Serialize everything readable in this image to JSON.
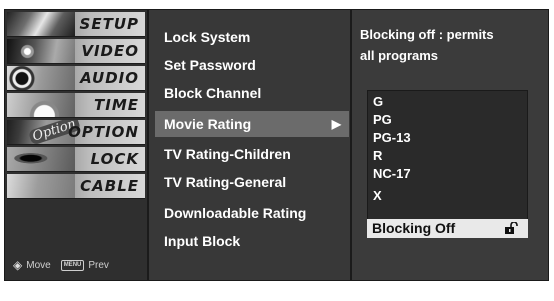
{
  "sidebar": {
    "items": [
      {
        "label": "SETUP"
      },
      {
        "label": "VIDEO"
      },
      {
        "label": "AUDIO"
      },
      {
        "label": "TIME"
      },
      {
        "label": "OPTION"
      },
      {
        "label": "LOCK"
      },
      {
        "label": "CABLE"
      }
    ],
    "option_badge": "Option",
    "nav_hint": {
      "move_icon": "move-arrows-icon",
      "move_label": "Move",
      "menu_key": "MENU",
      "prev_label": "Prev"
    }
  },
  "menu": {
    "items": [
      {
        "label": "Lock System"
      },
      {
        "label": "Set Password"
      },
      {
        "label": "Block Channel"
      },
      {
        "label": "Movie Rating",
        "selected": true,
        "arrow": "▶"
      },
      {
        "label": "TV Rating-Children"
      },
      {
        "label": "TV Rating-General"
      },
      {
        "label": "Downloadable Rating"
      },
      {
        "label": "Input Block"
      }
    ]
  },
  "panel": {
    "info_line1": "Blocking off : permits",
    "info_line2": "all programs",
    "ratings": [
      "G",
      "PG",
      "PG-13",
      "R",
      "NC-17",
      "X"
    ],
    "selected_option": "Blocking Off",
    "lock_icon": "unlocked-padlock-icon"
  },
  "colors": {
    "background": "#383838",
    "selected_row": "#6b6b6b",
    "text": "#ffffff",
    "selected_option_bg": "#e9e9e9"
  }
}
